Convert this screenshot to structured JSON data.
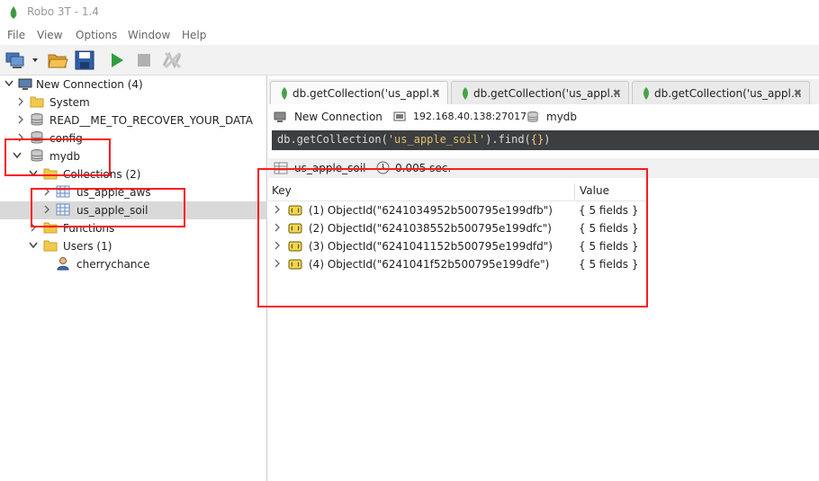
{
  "window": {
    "title": "Robo 3T - 1.4"
  },
  "menu": [
    "File",
    "View",
    "Options",
    "Window",
    "Help"
  ],
  "tree": {
    "connection": "New Connection (4)",
    "items": [
      {
        "label": "System"
      },
      {
        "label": "READ__ME_TO_RECOVER_YOUR_DATA"
      },
      {
        "label": "config"
      },
      {
        "label": "mydb"
      },
      {
        "label": "Collections (2)"
      },
      {
        "label": "us_apple_aws"
      },
      {
        "label": "us_apple_soil"
      },
      {
        "label": "Functions"
      },
      {
        "label": "Users (1)"
      },
      {
        "label": "cherrychance"
      }
    ]
  },
  "tabs": [
    {
      "label": "db.getCollection('us_appl…"
    },
    {
      "label": "db.getCollection('us_appl…"
    },
    {
      "label": "db.getCollection('us_appl…"
    }
  ],
  "info": {
    "connection": "New Connection",
    "server": "192.168.40.138:27017",
    "database": "mydb"
  },
  "query": {
    "prefix": "db.getCollection(",
    "collection": "'us_apple_soil'",
    "suffix": ").find(",
    "braces": "{}",
    "end": ")"
  },
  "result": {
    "collection": "us_apple_soil",
    "time": "0.005 sec."
  },
  "grid": {
    "headers": {
      "key": "Key",
      "value": "Value"
    },
    "rows": [
      {
        "key": "(1) ObjectId(\"6241034952b500795e199dfb\")",
        "value": "{ 5 fields }"
      },
      {
        "key": "(2) ObjectId(\"6241038552b500795e199dfc\")",
        "value": "{ 5 fields }"
      },
      {
        "key": "(3) ObjectId(\"6241041152b500795e199dfd\")",
        "value": "{ 5 fields }"
      },
      {
        "key": "(4) ObjectId(\"6241041f52b500795e199dfe\")",
        "value": "{ 5 fields }"
      }
    ]
  },
  "colors": {
    "query_bg": "#3c3f41",
    "query_text": "#dcdcdc",
    "query_string": "#e8bf6a",
    "query_paren": "#ffc66d",
    "annotation": "#ff1a1a",
    "mongo_green": "#47a248"
  }
}
